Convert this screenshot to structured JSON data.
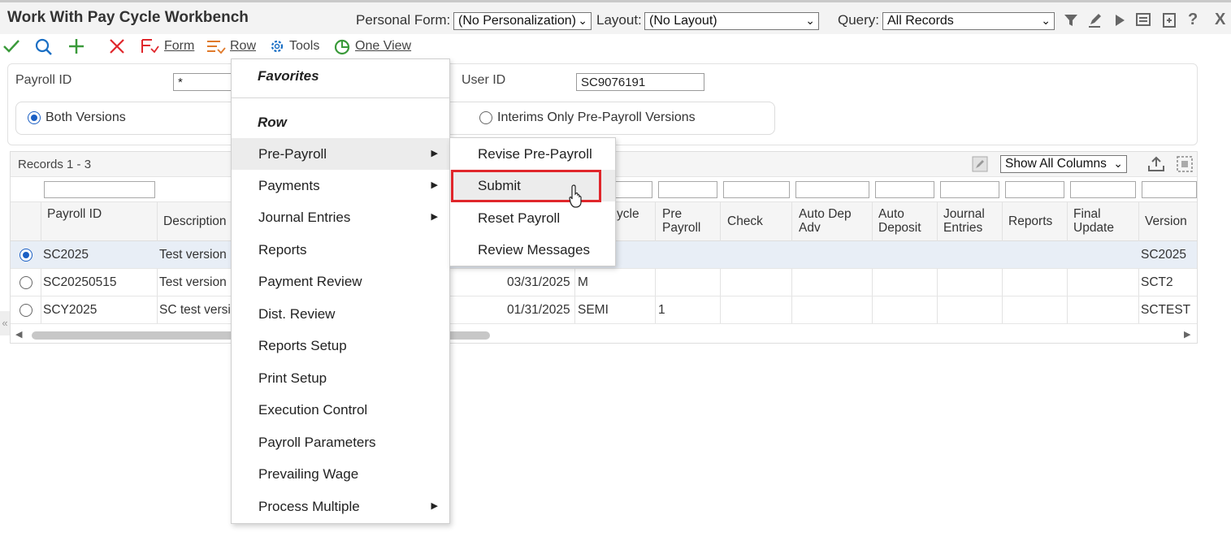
{
  "title": "Work With Pay Cycle Workbench",
  "header": {
    "personal_form_label": "Personal Form:",
    "personal_form_value": "(No Personalization)",
    "layout_label": "Layout:",
    "layout_value": "(No Layout)",
    "query_label": "Query:",
    "query_value": "All Records"
  },
  "toolbar": {
    "form_label": "Form",
    "row_label": "Row",
    "tools_label": "Tools",
    "one_view_label": "One View"
  },
  "search": {
    "payroll_id_label": "Payroll ID",
    "payroll_id_value": "*",
    "user_id_label": "User ID",
    "user_id_value": "SC9076191",
    "radio_both": "Both Versions",
    "radio_interims": "Interims Only Pre-Payroll Versions"
  },
  "grid": {
    "records": "Records 1 - 3",
    "show_columns": "Show All Columns",
    "columns": {
      "payroll_id": "Payroll ID",
      "description": "Description",
      "cycle": "ycle",
      "pre_payroll": "Pre Payroll",
      "check": "Check",
      "auto_dep_adv": "Auto Dep Adv",
      "auto_deposit": "Auto Deposit",
      "journal_entries": "Journal Entries",
      "reports": "Reports",
      "final_update": "Final Update",
      "version": "Version"
    },
    "rows": [
      {
        "payroll_id": "SC2025",
        "description": "Test version",
        "date": "",
        "cycle": "",
        "pre_payroll": "",
        "version": "SC2025",
        "selected": true
      },
      {
        "payroll_id": "SC20250515",
        "description": "Test version",
        "date": "03/31/2025",
        "cycle": "M",
        "pre_payroll": "",
        "version": "SCT2",
        "selected": false
      },
      {
        "payroll_id": "SCY2025",
        "description": "SC test versio",
        "date": "01/31/2025",
        "cycle": "SEMI",
        "pre_payroll": "1",
        "version": "SCTEST",
        "selected": false
      }
    ]
  },
  "row_menu": {
    "favorites": "Favorites",
    "row_heading": "Row",
    "items": [
      "Pre-Payroll",
      "Payments",
      "Journal Entries",
      "Reports",
      "Payment Review",
      "Dist. Review",
      "Reports Setup",
      "Print Setup",
      "Execution Control",
      "Payroll Parameters",
      "Prevailing Wage",
      "Process Multiple"
    ]
  },
  "submenu": {
    "items": [
      "Revise Pre-Payroll",
      "Submit",
      "Reset Payroll",
      "Review Messages"
    ]
  },
  "colors": {
    "accent_blue": "#1a5fc4",
    "highlight_red": "#e0262b",
    "ok_green": "#3a9a3a"
  }
}
